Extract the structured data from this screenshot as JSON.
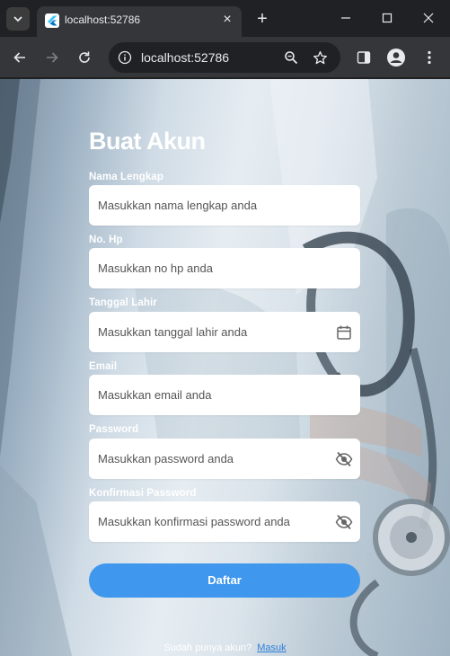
{
  "browser": {
    "tab_title": "localhost:52786",
    "url": "localhost:52786"
  },
  "page": {
    "title": "Buat Akun",
    "fields": [
      {
        "label": "Nama Lengkap",
        "placeholder": "Masukkan nama lengkap anda",
        "value": "",
        "suffix_icon": ""
      },
      {
        "label": "No. Hp",
        "placeholder": "Masukkan no hp anda",
        "value": "",
        "suffix_icon": ""
      },
      {
        "label": "Tanggal Lahir",
        "placeholder": "Masukkan tanggal lahir anda",
        "value": "",
        "suffix_icon": "calendar-icon"
      },
      {
        "label": "Email",
        "placeholder": "Masukkan email anda",
        "value": "",
        "suffix_icon": ""
      },
      {
        "label": "Password",
        "placeholder": "Masukkan password anda",
        "value": "",
        "suffix_icon": "eye-off-icon"
      },
      {
        "label": "Konfirmasi Password",
        "placeholder": "Masukkan konfirmasi password anda",
        "value": "",
        "suffix_icon": "eye-off-icon"
      }
    ],
    "submit_label": "Daftar",
    "footer_text": "Sudah punya akun?",
    "footer_link": "Masuk"
  },
  "colors": {
    "primary": "#3f97ee",
    "link": "#2f7fd8",
    "browser_dark": "#202124",
    "toolbar": "#35363a"
  }
}
